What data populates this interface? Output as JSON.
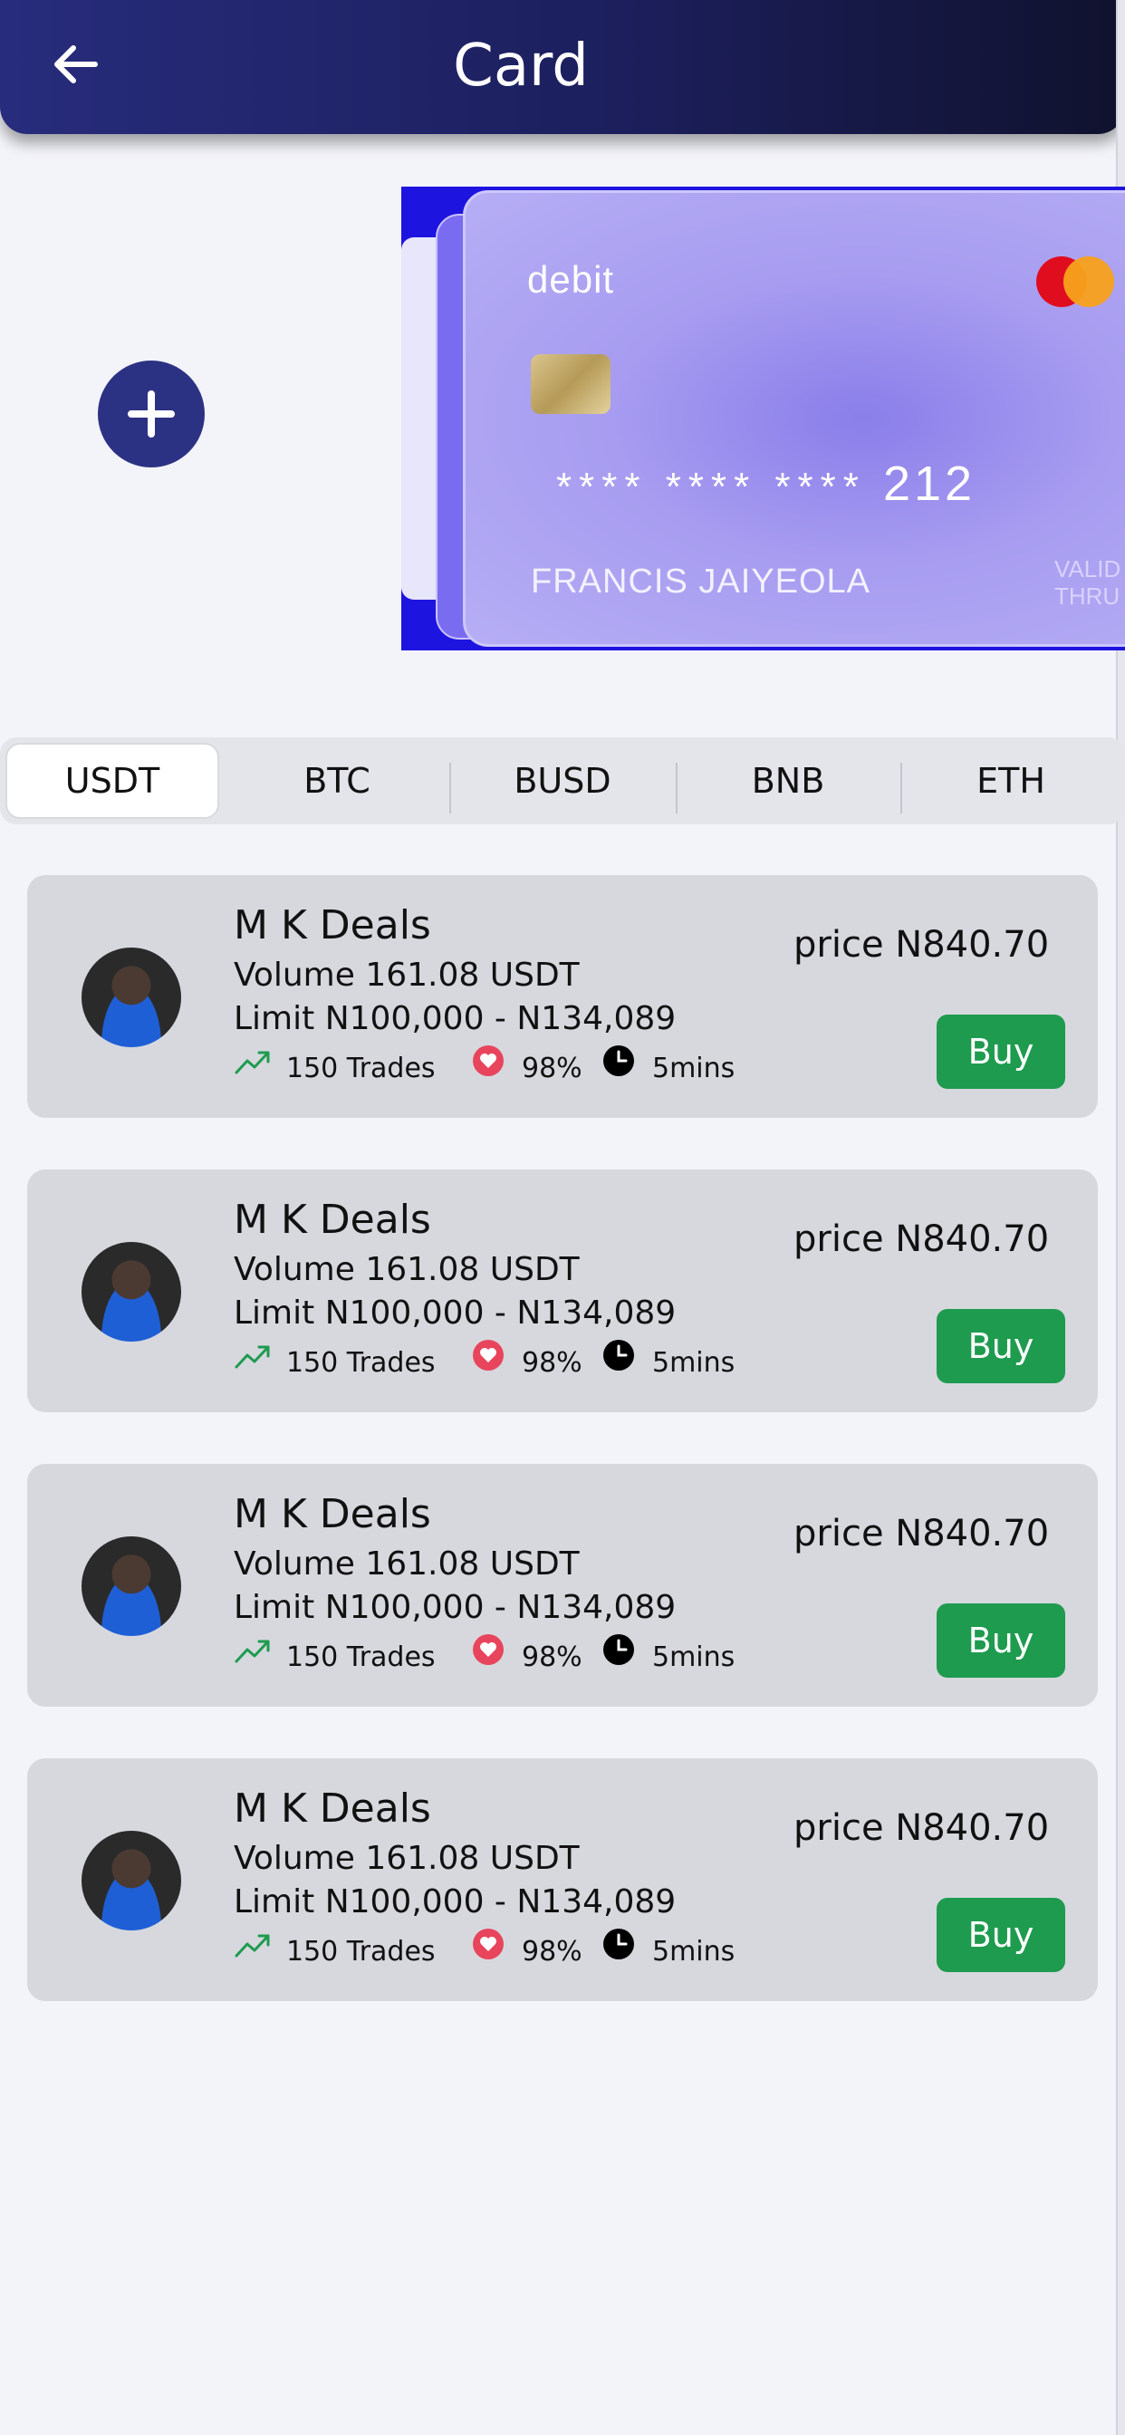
{
  "header": {
    "title": "Card"
  },
  "card": {
    "type_label": "debit",
    "masked_number": "**** **** ****",
    "number_suffix": "212",
    "holder_name": "FRANCIS JAIYEOLA",
    "valid_label_1": "VALID",
    "valid_label_2": "THRU"
  },
  "tabs": [
    "USDT",
    "BTC",
    "BUSD",
    "BNB",
    "ETH"
  ],
  "active_tab": "USDT",
  "offers": [
    {
      "merchant": "M K Deals",
      "volume": "Volume 161.08 USDT",
      "limit": "Limit N100,000 - N134,089",
      "trades": "150 Trades",
      "rating": "98%",
      "time": "5mins",
      "price": "price N840.70",
      "buy_label": "Buy"
    },
    {
      "merchant": "M K Deals",
      "volume": "Volume 161.08 USDT",
      "limit": "Limit N100,000 - N134,089",
      "trades": "150 Trades",
      "rating": "98%",
      "time": "5mins",
      "price": "price N840.70",
      "buy_label": "Buy"
    },
    {
      "merchant": "M K Deals",
      "volume": "Volume 161.08 USDT",
      "limit": "Limit N100,000 - N134,089",
      "trades": "150 Trades",
      "rating": "98%",
      "time": "5mins",
      "price": "price N840.70",
      "buy_label": "Buy"
    },
    {
      "merchant": "M K Deals",
      "volume": "Volume 161.08 USDT",
      "limit": "Limit N100,000 - N134,089",
      "trades": "150 Trades",
      "rating": "98%",
      "time": "5mins",
      "price": "price N840.70",
      "buy_label": "Buy"
    }
  ],
  "colors": {
    "header": "#1c1f5c",
    "accent": "#2c3283",
    "buy": "#1e9b4e",
    "heart": "#e8455d",
    "trend": "#1e9b4e"
  },
  "icons": {
    "back": "arrow-left-icon",
    "add": "plus-icon",
    "trend": "trending-up-icon",
    "heart": "heart-icon",
    "clock": "clock-icon"
  }
}
